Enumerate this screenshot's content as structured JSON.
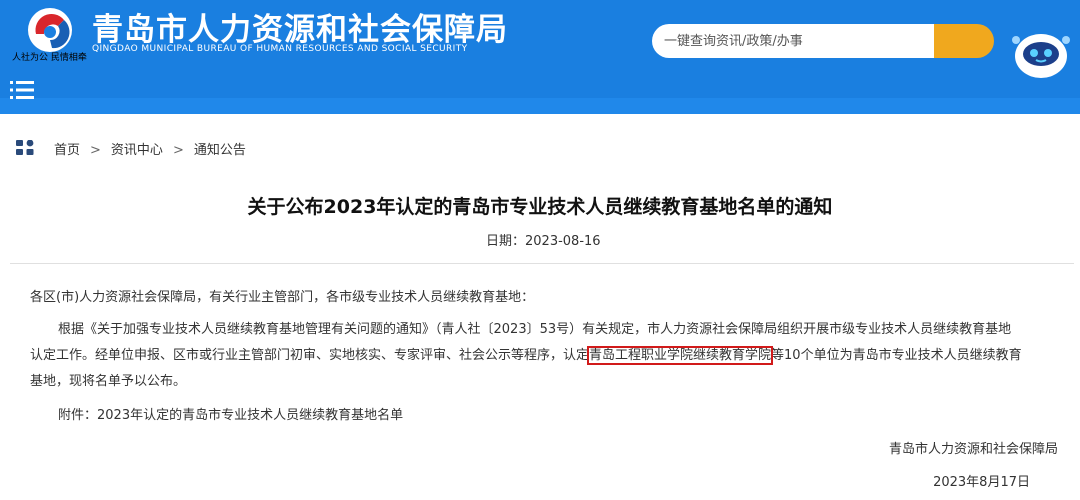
{
  "header": {
    "site_title": "青岛市人力资源和社会保障局",
    "site_subtitle": "QINGDAO MUNICIPAL BUREAU OF HUMAN RESOURCES AND SOCIAL SECURITY",
    "slogan": "人社为公 民情相牵",
    "colors": {
      "header_bg": "#1a7fe0",
      "search_button": "#f0a81e",
      "highlight_box": "#d11a1a"
    }
  },
  "search": {
    "placeholder": "一键查询资讯/政策/办事"
  },
  "breadcrumb": {
    "items": [
      "首页",
      "资讯中心",
      "通知公告"
    ],
    "separator": ">"
  },
  "article": {
    "title": "关于公布2023年认定的青岛市专业技术人员继续教育基地名单的通知",
    "date": "日期：2023-08-16",
    "para1": "各区(市)人力资源社会保障局，有关行业主管部门，各市级专业技术人员继续教育基地：",
    "para2_line1": "根据《关于加强专业技术人员继续教育基地管理有关问题的通知》（青人社〔2023〕53号）有关规定，市人力资源社会保障局组织开展市级专业技术人员继续教育基地",
    "para2_line2_pre": "认定工作。经单位申报、区市或行业主管部门初审、实地核实、专家评审、社会公示等程序，认定",
    "para2_highlight": "青岛工程职业学院继续教育学院",
    "para2_line2_post": "等10个单位为青岛市专业技术人员继续教育",
    "para2_line3": "基地，现将名单予以公布。",
    "attachment": "附件：2023年认定的青岛市专业技术人员继续教育基地名单",
    "sign_org": "青岛市人力资源和社会保障局",
    "sign_date": "2023年8月17日"
  }
}
